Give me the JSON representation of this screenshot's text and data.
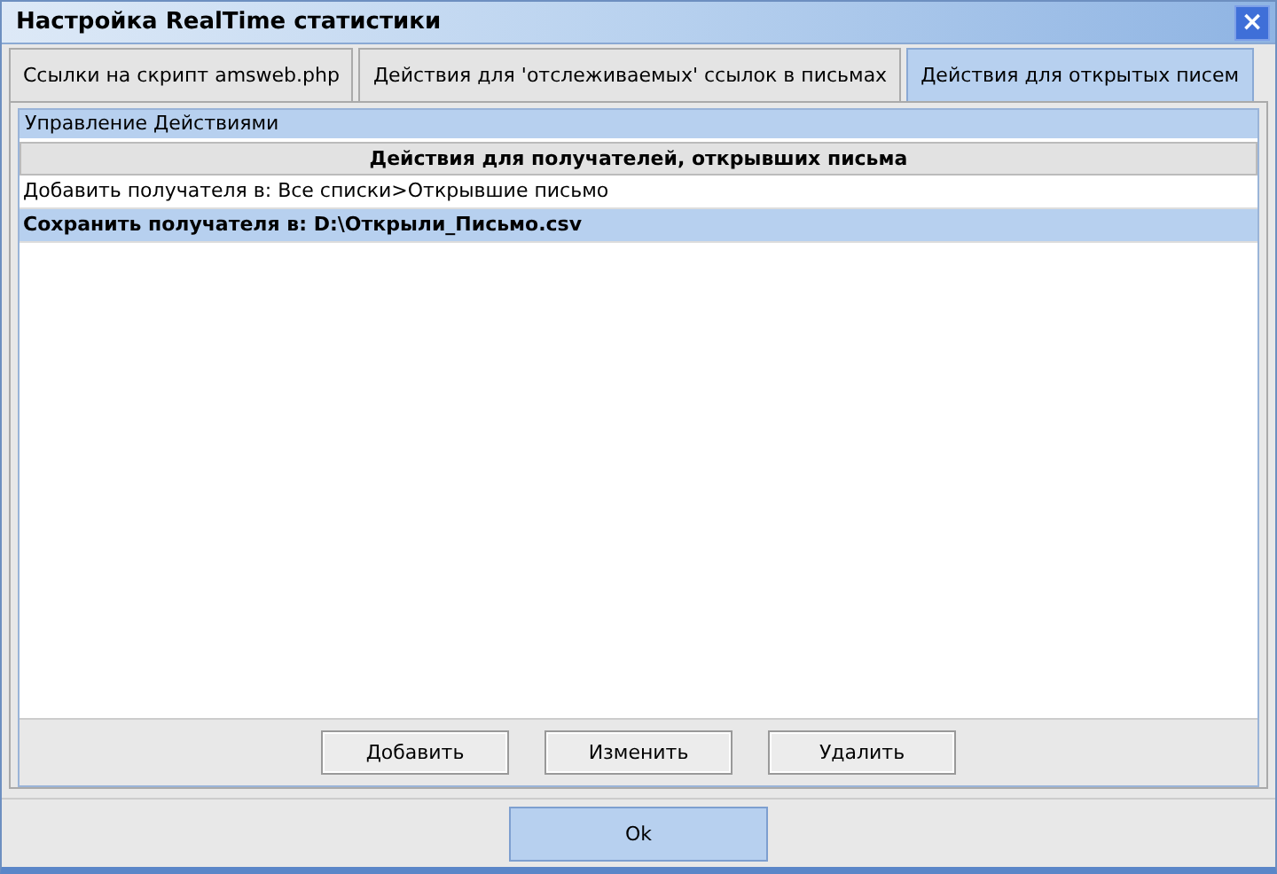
{
  "window": {
    "title": "Настройка RealTime статистики",
    "close": "×"
  },
  "tabs": [
    {
      "label": "Ссылки на скрипт amsweb.php",
      "selected": false
    },
    {
      "label": "Действия для 'отслеживаемых' ссылок в письмах",
      "selected": false
    },
    {
      "label": "Действия для открытых писем",
      "selected": true
    }
  ],
  "group": {
    "title": "Управление Действиями"
  },
  "table": {
    "columns": [
      "Действия для получателей, открывших письма"
    ],
    "rows": [
      {
        "text": "Добавить получателя в: Все списки>Открывшие письмо",
        "selected": false
      },
      {
        "text": "Сохранить получателя в: D:\\Открыли_Письмо.csv",
        "selected": true
      }
    ]
  },
  "actions": [
    "Добавить",
    "Изменить",
    "Удалить"
  ],
  "ok": "Ok"
}
